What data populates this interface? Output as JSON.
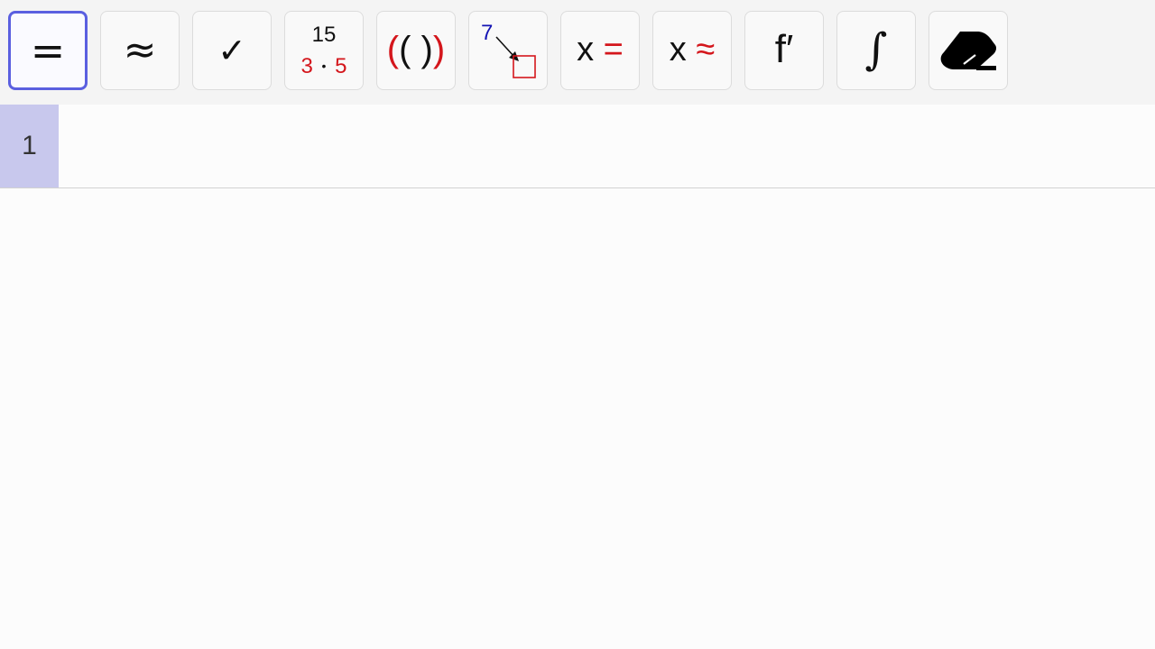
{
  "toolbar": {
    "tools": [
      {
        "name": "evaluate",
        "label": "="
      },
      {
        "name": "numeric",
        "label": "≈"
      },
      {
        "name": "keep-input",
        "label": "✓"
      },
      {
        "name": "factor",
        "top": "15",
        "left": "3",
        "dot": "•",
        "right": "5"
      },
      {
        "name": "expand",
        "outer_open": "(",
        "inner": "( )",
        "outer_close": ")"
      },
      {
        "name": "substitute",
        "number": "7"
      },
      {
        "name": "solve",
        "var": "x",
        "op": "="
      },
      {
        "name": "solve-numeric",
        "var": "x",
        "op": "≈"
      },
      {
        "name": "derivative",
        "label": "f′"
      },
      {
        "name": "integral",
        "label": "∫"
      },
      {
        "name": "delete",
        "icon": "eraser-icon"
      }
    ]
  },
  "row": {
    "number": "1",
    "input_value": ""
  },
  "colors": {
    "selected_border": "#5a5fe0",
    "row_number_bg": "#c8c8ed",
    "accent_red": "#d4161c",
    "accent_blue": "#1414b4"
  }
}
